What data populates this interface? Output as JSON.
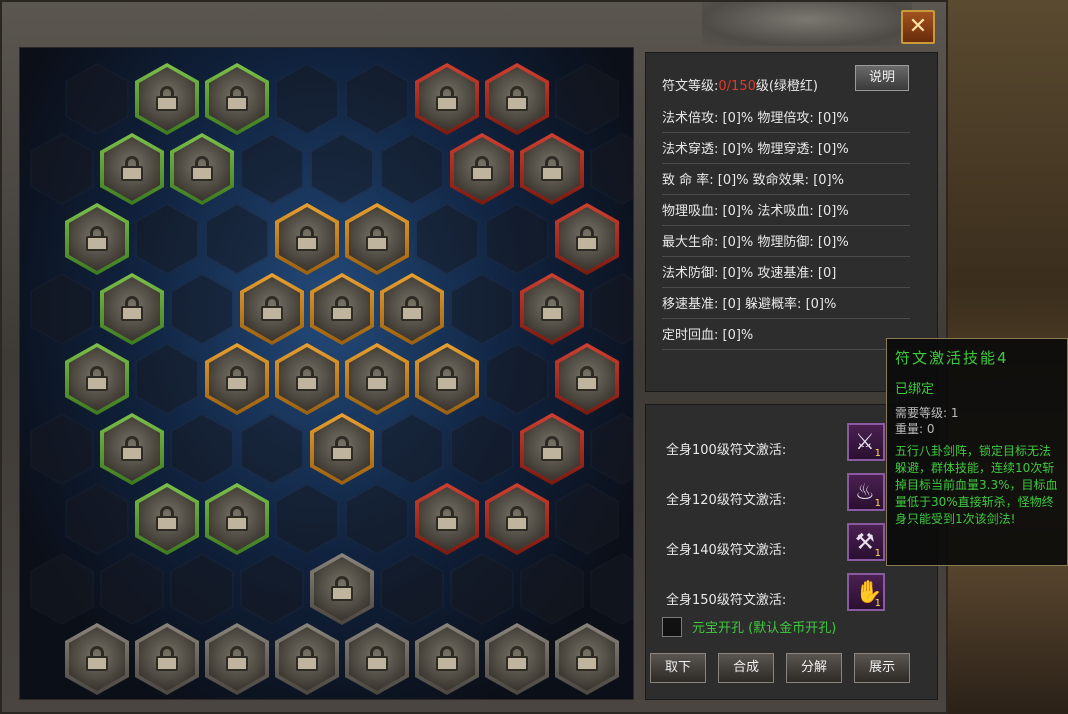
{
  "window": {
    "close_label": "✕"
  },
  "stats": {
    "rune_level_label": "符文等级:",
    "rune_level_value": "0/150",
    "rune_level_suffix": "级(绿橙红)",
    "explain_label": "说明",
    "rows": [
      "法术倍攻: [0]% 物理倍攻: [0]%",
      "法术穿透: [0]% 物理穿透: [0]%",
      "致 命 率: [0]% 致命效果: [0]%",
      "物理吸血: [0]% 法术吸血: [0]%",
      "最大生命: [0]% 物理防御: [0]%",
      "法术防御: [0]% 攻速基准: [0]",
      "移速基准: [0] 躲避概率: [0]%",
      "定时回血: [0]%"
    ]
  },
  "activations": [
    {
      "label": "全身100级符文激活:",
      "skill_icon": "sword-array-icon",
      "count": "1"
    },
    {
      "label": "全身120级符文激活:",
      "skill_icon": "flame-icon",
      "count": "1"
    },
    {
      "label": "全身140级符文激活:",
      "skill_icon": "axe-icon",
      "count": "1"
    },
    {
      "label": "全身150级符文激活:",
      "skill_icon": "palm-icon",
      "count": "1"
    }
  ],
  "yuanbao_label": "元宝开孔  (默认金币开孔)",
  "buttons": {
    "take_off": "取下",
    "combine": "合成",
    "decompose": "分解",
    "display": "展示"
  },
  "tooltip": {
    "title": "符文激活技能4",
    "bound": "已绑定",
    "required_level": "需要等级: 1",
    "weight": "重量: 0",
    "description": "五行八卦剑阵，锁定目标无法躲避，群体技能，连续10次斩掉目标当前血量3.3%，目标血量低于30%直接斩杀，怪物终身只能受到1次该剑法!"
  },
  "colors": {
    "green": "#3ec93e",
    "red": "#e03a2a",
    "orange": "#e8a030"
  }
}
